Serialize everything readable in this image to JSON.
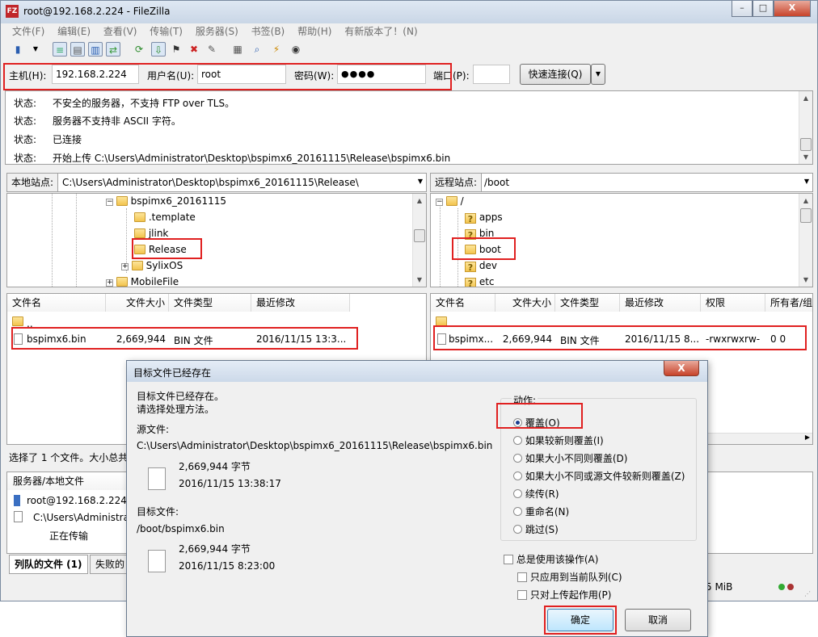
{
  "window": {
    "title": "root@192.168.2.224 - FileZilla",
    "app_icon": "FZ"
  },
  "menu": [
    "文件(F)",
    "编辑(E)",
    "查看(V)",
    "传输(T)",
    "服务器(S)",
    "书签(B)",
    "帮助(H)",
    "有新版本了！(N)"
  ],
  "quickconnect": {
    "host_label": "主机(H):",
    "host_value": "192.168.2.224",
    "user_label": "用户名(U):",
    "user_value": "root",
    "pass_label": "密码(W):",
    "pass_value": "●●●●",
    "port_label": "端口(P):",
    "port_value": "",
    "connect_label": "快速连接(Q)",
    "dropdown": "▼"
  },
  "log": [
    {
      "label": "状态:",
      "text": "不安全的服务器，不支持 FTP over TLS。"
    },
    {
      "label": "状态:",
      "text": "服务器不支持非 ASCII 字符。"
    },
    {
      "label": "状态:",
      "text": "已连接"
    },
    {
      "label": "状态:",
      "text": "开始上传 C:\\Users\\Administrator\\Desktop\\bspimx6_20161115\\Release\\bspimx6.bin"
    }
  ],
  "local": {
    "site_label": "本地站点:",
    "path": "C:\\Users\\Administrator\\Desktop\\bspimx6_20161115\\Release\\",
    "tree": [
      "bspimx6_20161115",
      ".template",
      "jlink",
      "Release",
      "SylixOS",
      "MobileFile"
    ],
    "headers": [
      "文件名",
      "文件大小",
      "文件类型",
      "最近修改"
    ],
    "rows": [
      {
        "name": "..",
        "size": "",
        "type": "",
        "modified": ""
      },
      {
        "name": "bspimx6.bin",
        "size": "2,669,944",
        "type": "BIN 文件",
        "modified": "2016/11/15 13:3..."
      }
    ],
    "status": "选择了 1 个文件。大小总共"
  },
  "remote": {
    "site_label": "远程站点:",
    "path": "/boot",
    "tree": [
      "/",
      "apps",
      "bin",
      "boot",
      "dev",
      "etc"
    ],
    "headers": [
      "文件名",
      "文件大小",
      "文件类型",
      "最近修改",
      "权限",
      "所有者/组"
    ],
    "rows": [
      {
        "name": "..",
        "size": "",
        "type": "",
        "modified": "",
        "perm": "",
        "owner": ""
      },
      {
        "name": "bspimx...",
        "size": "2,669,944",
        "type": "BIN 文件",
        "modified": "2016/11/15 8...",
        "perm": "-rwxrwxrw-",
        "owner": "0 0"
      }
    ]
  },
  "queue": {
    "headers": [
      "服务器/本地文件"
    ],
    "server": "root@192.168.2.224",
    "local_file": "C:\\Users\\Administra",
    "state": "正在传输",
    "tabs": [
      "列队的文件 (1)",
      "失败的"
    ],
    "status_size": "5 MiB"
  },
  "dialog": {
    "title": "目标文件已经存在",
    "close": "X",
    "intro_line1": "目标文件已经存在。",
    "intro_line2": "请选择处理方法。",
    "source_label": "源文件:",
    "source_path": "C:\\Users\\Administrator\\Desktop\\bspimx6_20161115\\Release\\bspimx6.bin",
    "source_size": "2,669,944 字节",
    "source_time": "2016/11/15 13:38:17",
    "target_label": "目标文件:",
    "target_path": "/boot/bspimx6.bin",
    "target_size": "2,669,944 字节",
    "target_time": "2016/11/15 8:23:00",
    "action_label": "动作:",
    "options": [
      "覆盖(O)",
      "如果较新则覆盖(I)",
      "如果大小不同则覆盖(D)",
      "如果大小不同或源文件较新则覆盖(Z)",
      "续传(R)",
      "重命名(N)",
      "跳过(S)"
    ],
    "selected_option": 0,
    "always_label": "总是使用该操作(A)",
    "queue_only_label": "只应用到当前队列(C)",
    "upload_only_label": "只对上传起作用(P)",
    "ok_label": "确定",
    "cancel_label": "取消"
  }
}
